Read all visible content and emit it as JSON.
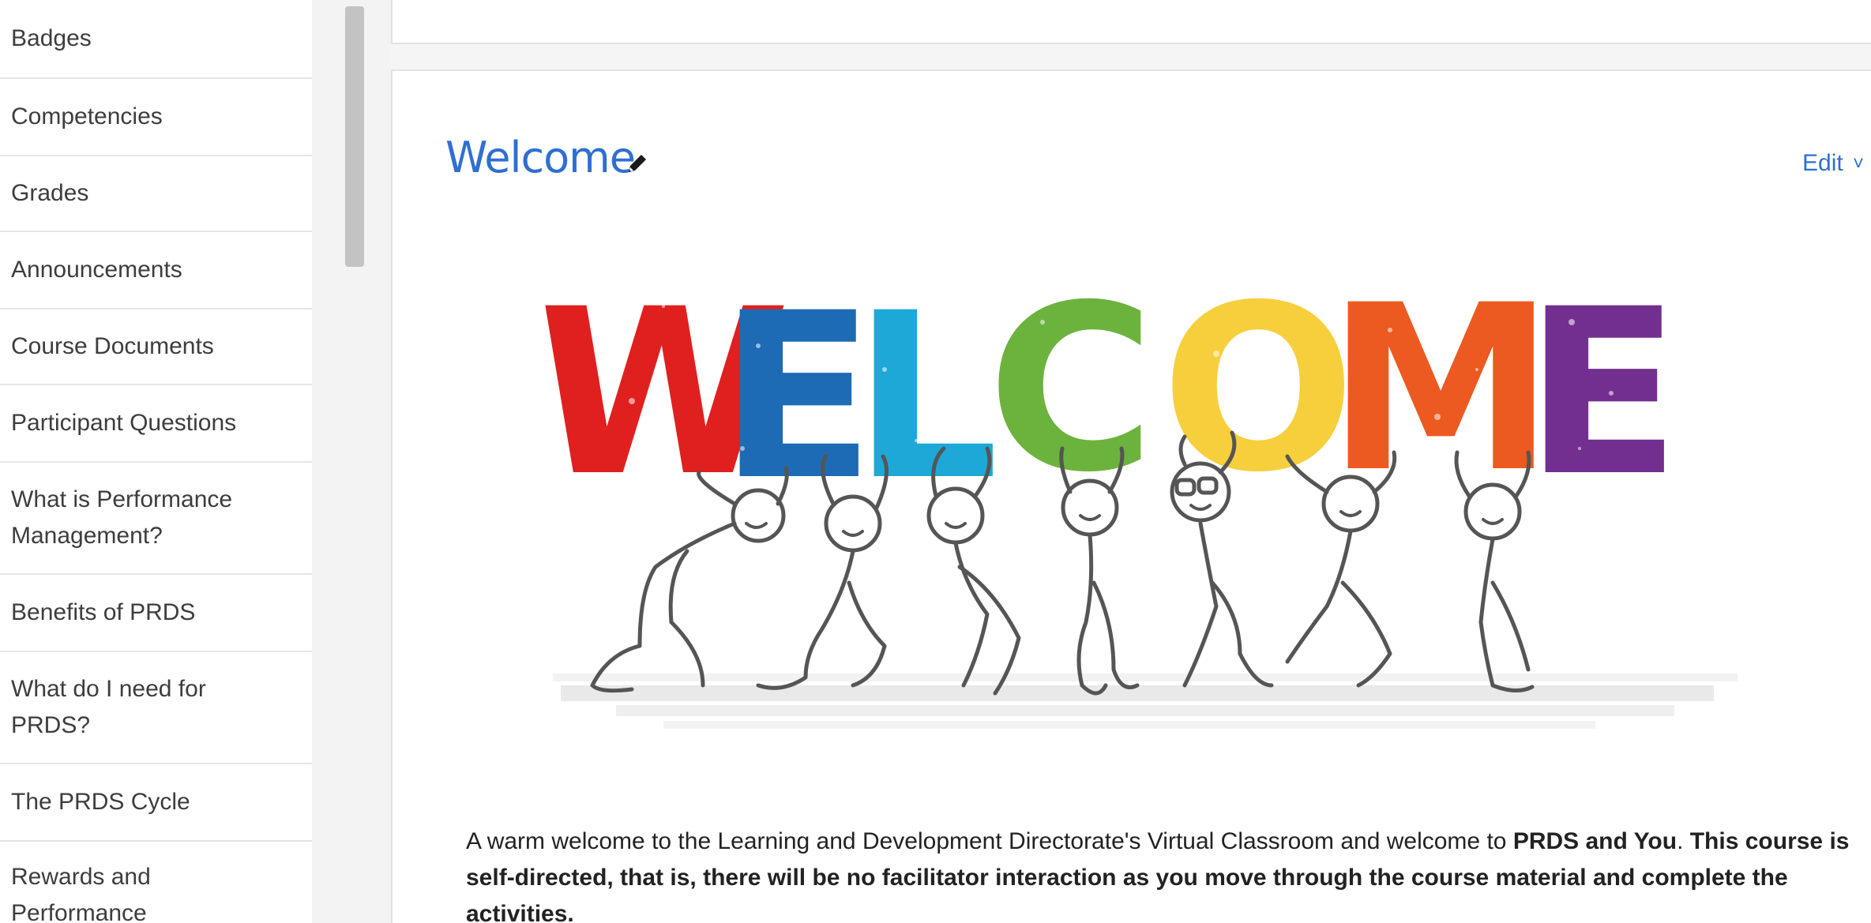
{
  "sidebar": {
    "items": [
      {
        "label": "Badges"
      },
      {
        "label": "Competencies"
      },
      {
        "label": "Grades"
      },
      {
        "label": "Announcements"
      },
      {
        "label": "Course Documents"
      },
      {
        "label": "Participant Questions"
      },
      {
        "label": "What is Performance Management?"
      },
      {
        "label": "Benefits of PRDS"
      },
      {
        "label": "What do I need for PRDS?"
      },
      {
        "label": "The PRDS Cycle"
      },
      {
        "label": "Rewards and Performance"
      }
    ]
  },
  "section": {
    "title": "Welcome",
    "edit_label": "Edit",
    "banner_letters": [
      "W",
      "E",
      "L",
      "C",
      "O",
      "M",
      "E"
    ],
    "banner_colors": [
      "#e0201f",
      "#1d6bb4",
      "#1ea8d8",
      "#6cb33e",
      "#f7cf3d",
      "#ec5a21",
      "#732f8f"
    ]
  },
  "description": {
    "part1": "A warm welcome to the Learning and Development Directorate's Virtual Classroom and welcome to ",
    "bold1": "PRDS and You",
    "part2": ".  ",
    "bold2": "This course is self-directed, that is, there will be no facilitator interaction as you move through the course material and complete the activities."
  },
  "colors": {
    "link": "#2f6fd1",
    "text": "#222222",
    "sidebar_text": "#3d3d3d"
  }
}
